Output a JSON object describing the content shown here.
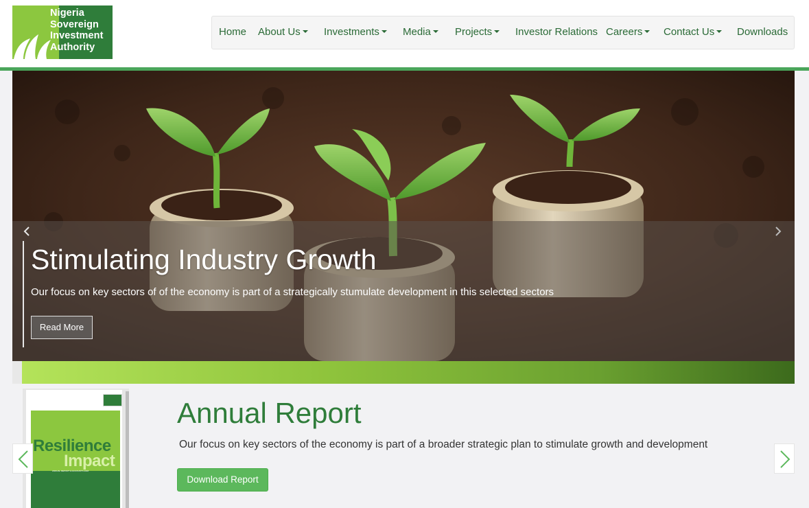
{
  "logo": {
    "lines": [
      "Nigeria",
      "Sovereign",
      "Investment",
      "Authority"
    ],
    "icon": "leaf-logo-icon"
  },
  "nav": {
    "items": [
      {
        "label": "Home",
        "dropdown": false
      },
      {
        "label": "About Us",
        "dropdown": true
      },
      {
        "label": "Investments",
        "dropdown": true
      },
      {
        "label": "Media",
        "dropdown": true
      },
      {
        "label": "Projects",
        "dropdown": true
      },
      {
        "label": "Investor Relations",
        "dropdown": false
      },
      {
        "label": "Careers",
        "dropdown": true
      },
      {
        "label": "Contact Us",
        "dropdown": true
      },
      {
        "label": "Downloads",
        "dropdown": false
      }
    ]
  },
  "hero": {
    "title": "Stimulating Industry Growth",
    "subtitle": "Our focus on key sectors of of the economy is part of a strategically stumulate development in this selected sectors",
    "button_label": "Read More",
    "prev_icon": "chevron-left-icon",
    "next_icon": "chevron-right-icon"
  },
  "report": {
    "title": "Annual Report",
    "description": "Our focus on key sectors of the economy is part of a broader strategic plan to stimulate growth and development",
    "button_label": "Download Report",
    "cover": {
      "word1": "Resilience",
      "word2": "Impact",
      "small": "ANNUAL REPORT & ACCOUNTS 2018"
    }
  },
  "colors": {
    "brand_green": "#2f7d3a",
    "button_green": "#5cb85c",
    "nav_text": "#2a6a36"
  }
}
